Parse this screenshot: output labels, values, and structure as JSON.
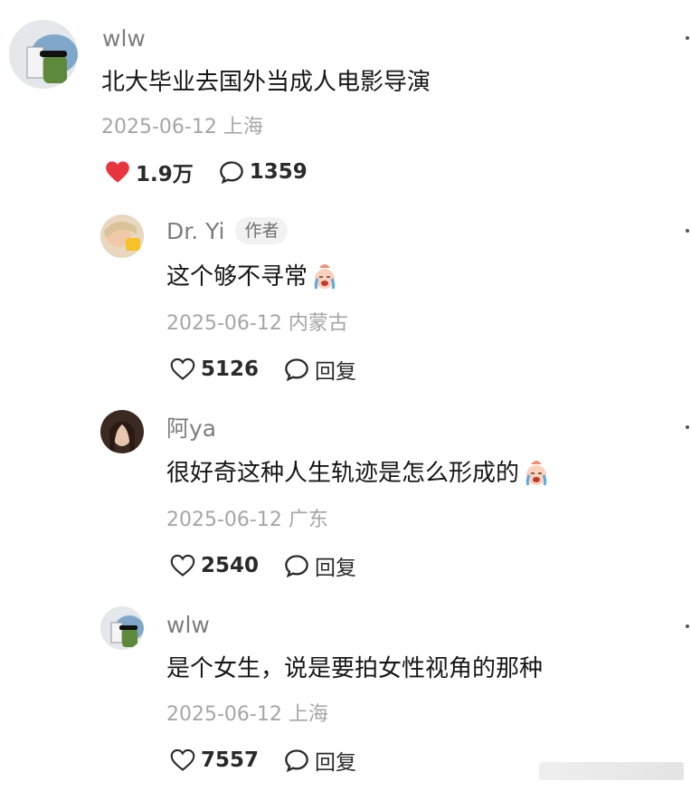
{
  "comments": [
    {
      "username": "wlw",
      "text": "北大毕业去国外当成人电影导演",
      "meta": "2025-06-12 上海",
      "likes": "1.9万",
      "replies": "1359"
    },
    {
      "username": "Dr. Yi",
      "badge": "作者",
      "text": "这个够不寻常",
      "meta": "2025-06-12 内蒙古",
      "likes": "5126",
      "reply_label": "回复"
    },
    {
      "username": "阿ya",
      "text": "很好奇这种人生轨迹是怎么形成的",
      "meta": "2025-06-12 广东",
      "likes": "2540",
      "reply_label": "回复"
    },
    {
      "username": "wlw",
      "text": "是个女生，说是要拍女性视角的那种",
      "meta": "2025-06-12 上海",
      "likes": "7557",
      "reply_label": "回复"
    }
  ],
  "colors": {
    "liked": "#e8363f",
    "muted": "#a6a6a6"
  }
}
